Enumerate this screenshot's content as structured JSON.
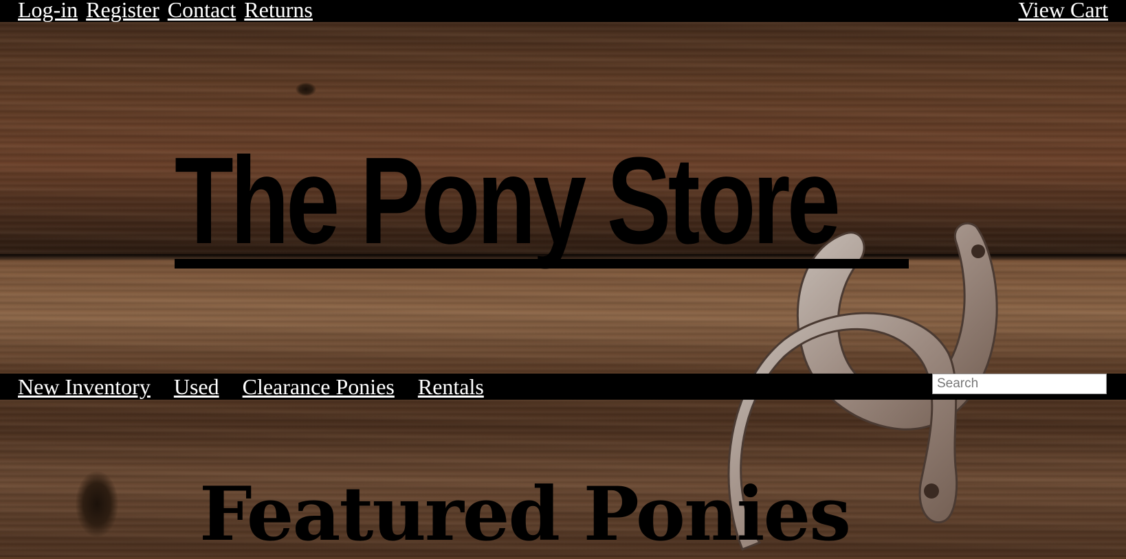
{
  "top_nav": {
    "links": [
      "Log-in",
      "Register",
      "Contact",
      "Returns"
    ],
    "cart_label": "View Cart"
  },
  "hero": {
    "title": "The Pony Store"
  },
  "main_nav": {
    "links": [
      "New Inventory",
      "Used",
      "Clearance Ponies",
      "Rentals"
    ],
    "search_placeholder": "Search"
  },
  "featured": {
    "heading": "Featured Ponies"
  },
  "decor": {
    "background": "wooden planks",
    "ornament": "horseshoe-icon",
    "colors": {
      "bars": "#000000",
      "link_text": "#ffffff"
    }
  }
}
